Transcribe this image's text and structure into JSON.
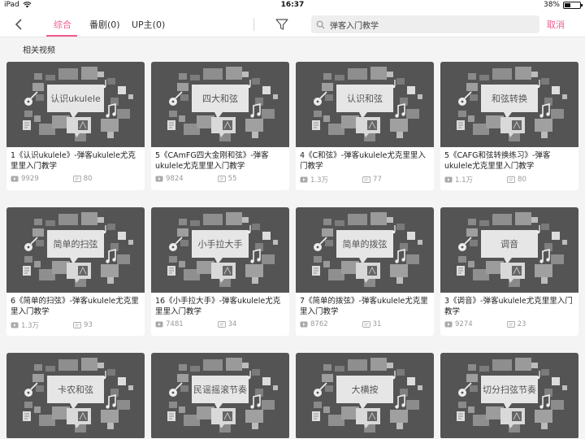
{
  "status": {
    "carrier": "iPad",
    "time": "16:37",
    "battery": "38%",
    "battery_fraction": 0.38
  },
  "nav": {
    "tabs": [
      {
        "label": "综合",
        "active": true
      },
      {
        "label": "番剧(0)",
        "active": false
      },
      {
        "label": "UP主(0)",
        "active": false
      }
    ],
    "search_value": "弹客入门教学",
    "cancel": "取消"
  },
  "section_title": "相关视频",
  "colors": {
    "accent": "#f25d8e",
    "thumb_bg": "#545454"
  },
  "videos": [
    {
      "thumb_text": "认识ukulele",
      "title": "1《认识ukulele》-弹客ukulele尤克里里入门教学",
      "plays": "9929",
      "danmaku": "80"
    },
    {
      "thumb_text": "四大和弦",
      "title": "5《CAmFG四大金刚和弦》-弹客ukulele尤克里里入门教学",
      "plays": "9824",
      "danmaku": "55"
    },
    {
      "thumb_text": "认识和弦",
      "title": "4《C和弦》-弹客ukulele尤克里里入门教学",
      "plays": "1.3万",
      "danmaku": "77"
    },
    {
      "thumb_text": "和弦转换",
      "title": "5《CAFG和弦转换练习》-弹客ukulele尤克里里入门教学",
      "plays": "1.1万",
      "danmaku": "80"
    },
    {
      "thumb_text": "简单的扫弦",
      "title": "6《简单的扫弦》-弹客ukulele尤克里里入门教学",
      "plays": "1.3万",
      "danmaku": "93"
    },
    {
      "thumb_text": "小手拉大手",
      "title": "16《小手拉大手》-弹客ukulele尤克里里入门教学",
      "plays": "7481",
      "danmaku": "34"
    },
    {
      "thumb_text": "简单的拨弦",
      "title": "7《简单的拨弦》-弹客ukulele尤克里里入门教学",
      "plays": "8762",
      "danmaku": "31"
    },
    {
      "thumb_text": "调音",
      "title": "3《调音》-弹客ukulele尤克里里入门教学",
      "plays": "9274",
      "danmaku": "23"
    },
    {
      "thumb_text": "卡农和弦",
      "title": "",
      "plays": "",
      "danmaku": ""
    },
    {
      "thumb_text": "民谣摇滚节奏",
      "title": "",
      "plays": "",
      "danmaku": ""
    },
    {
      "thumb_text": "大横按",
      "title": "",
      "plays": "",
      "danmaku": ""
    },
    {
      "thumb_text": "切分扫弦节奏",
      "title": "",
      "plays": "",
      "danmaku": ""
    }
  ]
}
